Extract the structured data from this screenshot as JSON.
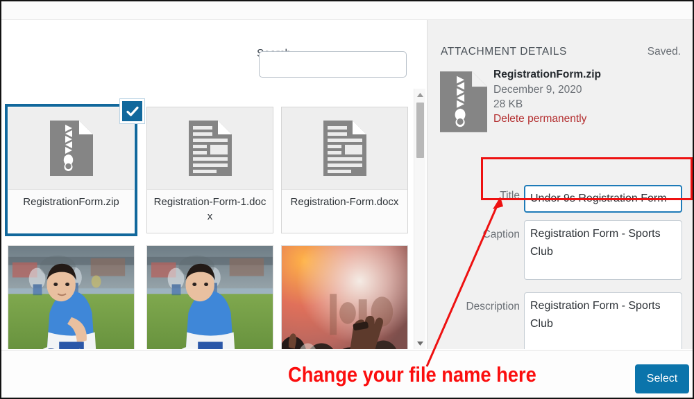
{
  "search": {
    "label": "Search",
    "value": "",
    "placeholder": ""
  },
  "media_grid": {
    "files": [
      {
        "name": "RegistrationForm.zip",
        "type": "zip",
        "selected": true
      },
      {
        "name": "Registration-Form-1.docx",
        "type": "docx",
        "selected": false
      },
      {
        "name": "Registration-Form.docx",
        "type": "docx",
        "selected": false
      }
    ],
    "images": [
      {
        "alt": "boy kneeling with soccer ball on grass field",
        "kind": "soccer"
      },
      {
        "alt": "boy kneeling with soccer ball on grass field",
        "kind": "soccer"
      },
      {
        "alt": "concert crowd with raised hand and stage lights",
        "kind": "concert"
      }
    ]
  },
  "details": {
    "heading": "ATTACHMENT DETAILS",
    "saved_status": "Saved.",
    "attachment": {
      "filename": "RegistrationForm.zip",
      "date": "December 9, 2020",
      "filesize": "28 KB",
      "delete_label": "Delete permanently"
    },
    "fields": {
      "title": {
        "label": "Title",
        "value": "Under 9s Registration Form"
      },
      "caption": {
        "label": "Caption",
        "value": "Registration Form - Sports Club"
      },
      "description": {
        "label": "Description",
        "value": "Registration Form - Sports Club"
      },
      "next_field": {
        "value": ""
      }
    }
  },
  "annotation": {
    "callout_text": "Change your file name here",
    "color": "#fb0e0e"
  },
  "footer": {
    "select_label": "Select"
  },
  "colors": {
    "accent_blue": "#0b74ab",
    "selection_blue": "#11689c",
    "delete_red": "#b32d2e",
    "panel_bg": "#f1f1f1"
  }
}
